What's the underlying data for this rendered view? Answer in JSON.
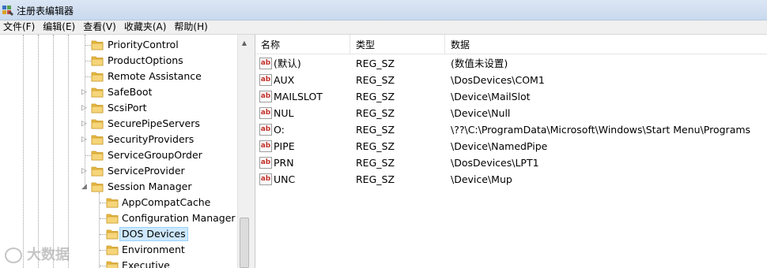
{
  "window": {
    "title": "注册表编辑器",
    "app_icon": "registry-editor-icon"
  },
  "menu": [
    "文件(F)",
    "编辑(E)",
    "查看(V)",
    "收藏夹(A)",
    "帮助(H)"
  ],
  "tree": {
    "items": [
      {
        "label": "PriorityControl",
        "expander": "",
        "selected": false
      },
      {
        "label": "ProductOptions",
        "expander": "",
        "selected": false
      },
      {
        "label": "Remote Assistance",
        "expander": "",
        "selected": false
      },
      {
        "label": "SafeBoot",
        "expander": "collapsed",
        "selected": false
      },
      {
        "label": "ScsiPort",
        "expander": "collapsed",
        "selected": false
      },
      {
        "label": "SecurePipeServers",
        "expander": "collapsed",
        "selected": false
      },
      {
        "label": "SecurityProviders",
        "expander": "collapsed",
        "selected": false
      },
      {
        "label": "ServiceGroupOrder",
        "expander": "",
        "selected": false
      },
      {
        "label": "ServiceProvider",
        "expander": "collapsed",
        "selected": false
      },
      {
        "label": "Session Manager",
        "expander": "expanded",
        "selected": false
      },
      {
        "label": "AppCompatCache",
        "expander": "",
        "selected": false
      },
      {
        "label": "Configuration Manager",
        "expander": "",
        "selected": false
      },
      {
        "label": "DOS Devices",
        "expander": "",
        "selected": true
      },
      {
        "label": "Environment",
        "expander": "",
        "selected": false
      },
      {
        "label": "Executive",
        "expander": "",
        "selected": false
      }
    ]
  },
  "list": {
    "columns": [
      "名称",
      "类型",
      "数据"
    ],
    "rows": [
      {
        "name": "(默认)",
        "type": "REG_SZ",
        "data": "(数值未设置)",
        "icon": "ab"
      },
      {
        "name": "AUX",
        "type": "REG_SZ",
        "data": "\\DosDevices\\COM1",
        "icon": "ab"
      },
      {
        "name": "MAILSLOT",
        "type": "REG_SZ",
        "data": "\\Device\\MailSlot",
        "icon": "ab"
      },
      {
        "name": "NUL",
        "type": "REG_SZ",
        "data": "\\Device\\Null",
        "icon": "ab"
      },
      {
        "name": "O:",
        "type": "REG_SZ",
        "data": "\\??\\C:\\ProgramData\\Microsoft\\Windows\\Start Menu\\Programs",
        "icon": "ab"
      },
      {
        "name": "PIPE",
        "type": "REG_SZ",
        "data": "\\Device\\NamedPipe",
        "icon": "ab"
      },
      {
        "name": "PRN",
        "type": "REG_SZ",
        "data": "\\DosDevices\\LPT1",
        "icon": "ab"
      },
      {
        "name": "UNC",
        "type": "REG_SZ",
        "data": "\\Device\\Mup",
        "icon": "ab"
      }
    ]
  },
  "watermark": {
    "text": "大数据"
  },
  "colors": {
    "selection": "#cde8ff",
    "folder": "#f3c65a",
    "icon_text": "#c0302a"
  }
}
